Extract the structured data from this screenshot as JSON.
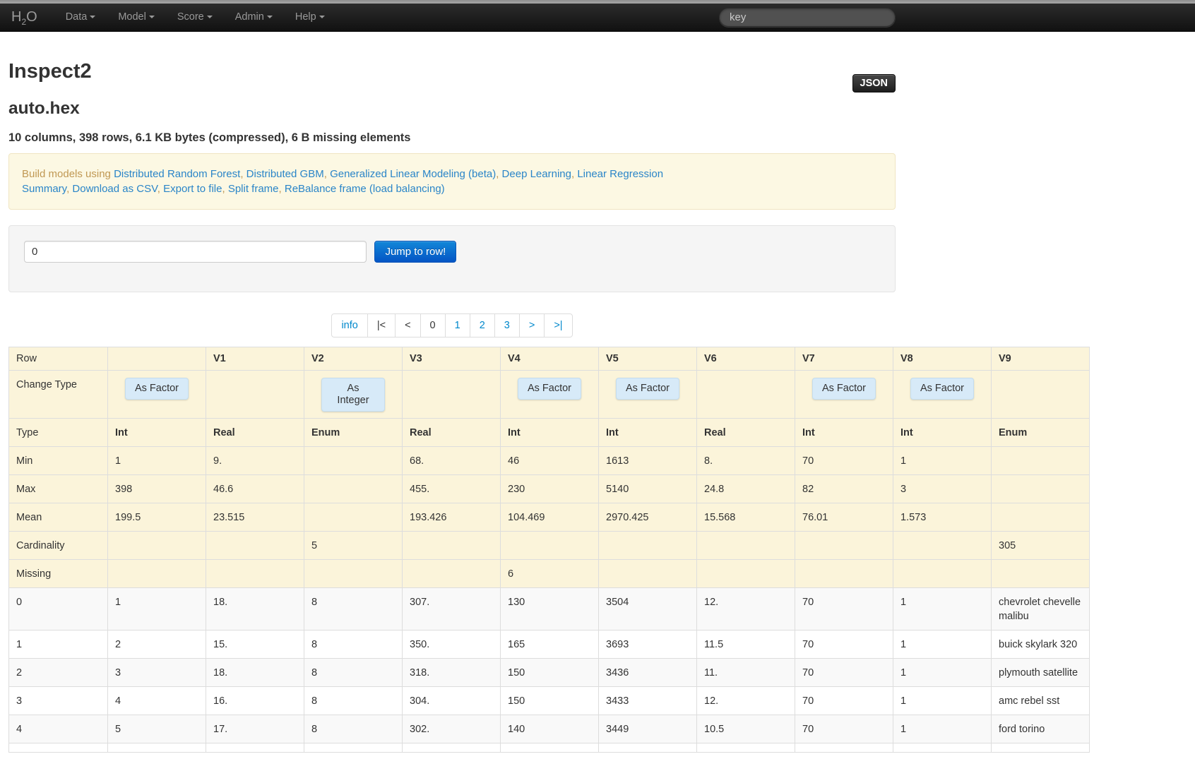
{
  "navbar": {
    "brand": {
      "h": "H",
      "sub": "2",
      "o": "O"
    },
    "menus": [
      {
        "label": "Data"
      },
      {
        "label": "Model"
      },
      {
        "label": "Score"
      },
      {
        "label": "Admin"
      },
      {
        "label": "Help"
      }
    ],
    "search_placeholder": "key"
  },
  "header": {
    "json_button": "JSON",
    "page_title": "Inspect2",
    "frame_name": "auto.hex",
    "summary": "10 columns, 398 rows, 6.1 KB bytes (compressed), 6 B missing elements"
  },
  "build_bar": {
    "intro": "Build models using ",
    "separator": ", ",
    "model_links": [
      "Distributed Random Forest",
      "Distributed GBM",
      "Generalized Linear Modeling (beta)",
      "Deep Learning",
      "Linear Regression"
    ],
    "action_links": [
      "Summary",
      "Download as CSV",
      "Export to file",
      "Split frame",
      "ReBalance frame (load balancing)"
    ]
  },
  "jump": {
    "input_value": "0",
    "button_label": "Jump to row!"
  },
  "pagination": {
    "items": [
      {
        "label": "info",
        "style": "link"
      },
      {
        "label": "|<",
        "style": "plain"
      },
      {
        "label": "<",
        "style": "plain"
      },
      {
        "label": "0",
        "style": "plain"
      },
      {
        "label": "1",
        "style": "link"
      },
      {
        "label": "2",
        "style": "link"
      },
      {
        "label": "3",
        "style": "link"
      },
      {
        "label": ">",
        "style": "link"
      },
      {
        "label": ">|",
        "style": "link"
      }
    ]
  },
  "table": {
    "columns": [
      "Row",
      "",
      "V1",
      "V2",
      "V3",
      "V4",
      "V5",
      "V6",
      "V7",
      "V8",
      "V9"
    ],
    "change_type": {
      "label": "Change Type",
      "buttons": [
        {
          "label": "As Factor"
        },
        null,
        {
          "label": "As Integer",
          "wrap": true
        },
        null,
        {
          "label": "As Factor"
        },
        {
          "label": "As Factor"
        },
        null,
        {
          "label": "As Factor"
        },
        {
          "label": "As Factor"
        },
        null
      ]
    },
    "summary_rows": [
      {
        "label": "Type",
        "bold": true,
        "values": [
          "Int",
          "Real",
          "Enum",
          "Real",
          "Int",
          "Int",
          "Real",
          "Int",
          "Int",
          "Enum"
        ]
      },
      {
        "label": "Min",
        "bold": false,
        "values": [
          "1",
          "9.",
          "",
          "68.",
          "46",
          "1613",
          "8.",
          "70",
          "1",
          ""
        ]
      },
      {
        "label": "Max",
        "bold": false,
        "values": [
          "398",
          "46.6",
          "",
          "455.",
          "230",
          "5140",
          "24.8",
          "82",
          "3",
          ""
        ]
      },
      {
        "label": "Mean",
        "bold": false,
        "values": [
          "199.5",
          "23.515",
          "",
          "193.426",
          "104.469",
          "2970.425",
          "15.568",
          "76.01",
          "1.573",
          ""
        ]
      },
      {
        "label": "Cardinality",
        "bold": false,
        "values": [
          "",
          "",
          "5",
          "",
          "",
          "",
          "",
          "",
          "",
          "305"
        ]
      },
      {
        "label": "Missing",
        "bold": false,
        "values": [
          "",
          "",
          "",
          "",
          "6",
          "",
          "",
          "",
          "",
          ""
        ]
      }
    ],
    "data_rows": [
      {
        "label": "0",
        "values": [
          "1",
          "18.",
          "8",
          "307.",
          "130",
          "3504",
          "12.",
          "70",
          "1",
          "chevrolet chevelle malibu"
        ]
      },
      {
        "label": "1",
        "values": [
          "2",
          "15.",
          "8",
          "350.",
          "165",
          "3693",
          "11.5",
          "70",
          "1",
          "buick skylark 320"
        ]
      },
      {
        "label": "2",
        "values": [
          "3",
          "18.",
          "8",
          "318.",
          "150",
          "3436",
          "11.",
          "70",
          "1",
          "plymouth satellite"
        ]
      },
      {
        "label": "3",
        "values": [
          "4",
          "16.",
          "8",
          "304.",
          "150",
          "3433",
          "12.",
          "70",
          "1",
          "amc rebel sst"
        ]
      },
      {
        "label": "4",
        "values": [
          "5",
          "17.",
          "8",
          "302.",
          "140",
          "3449",
          "10.5",
          "70",
          "1",
          "ford torino"
        ]
      }
    ]
  },
  "colors": {
    "accent_blue": "#0088cc",
    "warning_bg": "#fcf8e3",
    "warning_text": "#c09853",
    "table_header_bg": "#fbf4da",
    "change_button_bg": "#d7eaf8",
    "primary_button_top": "#1287d8",
    "primary_button_bottom": "#0455c5",
    "inverse_button": "#2d2d2d",
    "navbar_bg": "#1a1a1a"
  }
}
